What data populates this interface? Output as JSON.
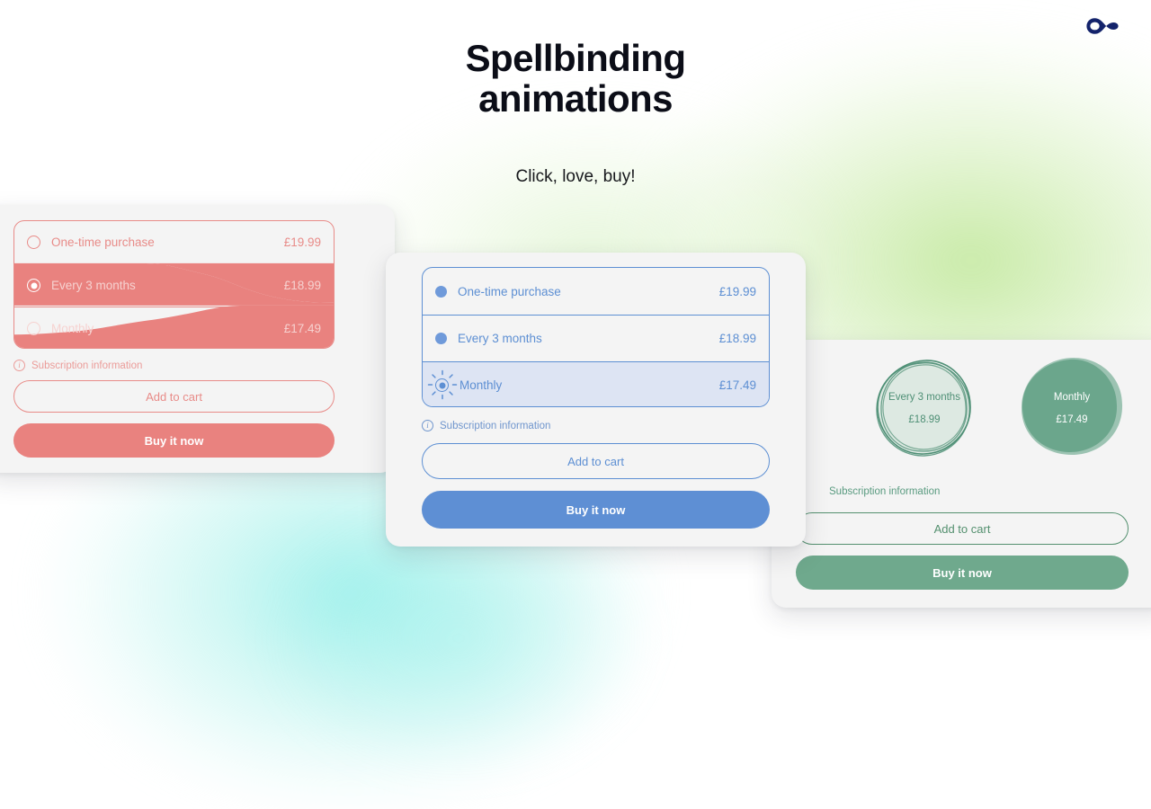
{
  "header": {
    "logo_icon": "infinity-logo",
    "logo_color": "#13236b",
    "title_line1": "Spellbinding",
    "title_line2": "animations",
    "subtitle": "Click, love, buy!"
  },
  "theme": {
    "pink": "#e88b88",
    "pink_solid": "#e9827f",
    "blue": "#5d8fd3",
    "blue_solid": "#5e8fd4",
    "blue_row_bg": "#dde4f3",
    "green": "#54906f",
    "green_solid": "#6fa98d",
    "green_bubble_fill": "#dde9e2",
    "card_bg": "#f4f4f4",
    "glow_green": "#b2e283",
    "glow_cyan": "#8ceee8"
  },
  "cards": {
    "pink": {
      "name": "pink-variant",
      "options": [
        {
          "label": "One-time purchase",
          "price": "£19.99",
          "selected": false,
          "dimmed": false
        },
        {
          "label": "Every 3 months",
          "price": "£18.99",
          "selected": true,
          "dimmed": true
        },
        {
          "label": "Monthly",
          "price": "£17.49",
          "selected": false,
          "dimmed": true
        }
      ],
      "subscription_info": "Subscription information",
      "info_icon": "info-circle-icon",
      "add_to_cart": "Add to cart",
      "buy_it_now": "Buy it now"
    },
    "blue": {
      "name": "blue-variant",
      "options": [
        {
          "label": "One-time purchase",
          "price": "£19.99",
          "selected": false,
          "active": false
        },
        {
          "label": "Every 3 months",
          "price": "£18.99",
          "selected": false,
          "active": false
        },
        {
          "label": "Monthly",
          "price": "£17.49",
          "selected": true,
          "active": true
        }
      ],
      "subscription_info": "Subscription information",
      "info_icon": "info-circle-icon",
      "add_to_cart": "Add to cart",
      "buy_it_now": "Buy it now"
    },
    "green": {
      "name": "green-variant",
      "bubbles": [
        {
          "label": "Every 3 months",
          "price": "£18.99",
          "selected": false,
          "style": "sketch-outline"
        },
        {
          "label": "Monthly",
          "price": "£17.49",
          "selected": true,
          "style": "filled-blob"
        }
      ],
      "subscription_info": "Subscription information",
      "info_icon": "info-circle-icon",
      "add_to_cart": "Add to cart",
      "buy_it_now": "Buy it now"
    }
  }
}
